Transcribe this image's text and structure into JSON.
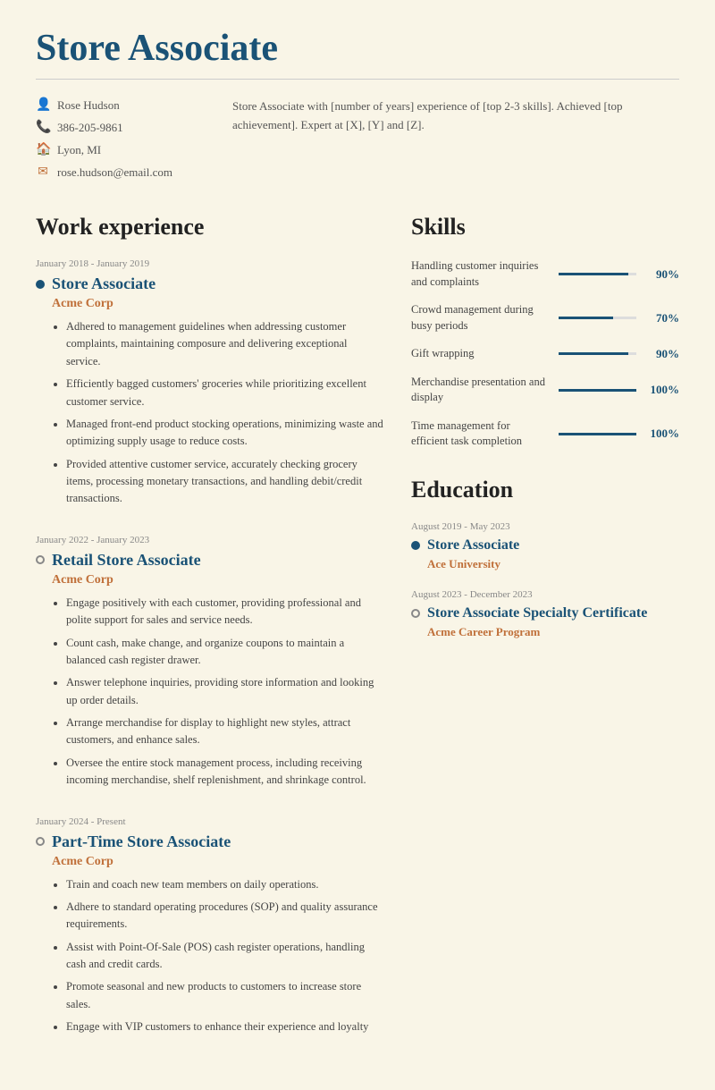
{
  "page": {
    "title": "Store Associate"
  },
  "contact": {
    "name": "Rose Hudson",
    "phone": "386-205-9861",
    "location": "Lyon, MI",
    "email": "rose.hudson@email.com"
  },
  "summary": "Store Associate with [number of years] experience of [top 2-3 skills]. Achieved [top achievement]. Expert at [X], [Y] and [Z].",
  "work_experience": {
    "section_title": "Work experience",
    "jobs": [
      {
        "date": "January 2018 - January 2019",
        "title": "Store Associate",
        "company": "Acme Corp",
        "bullet_type": "filled",
        "bullets": [
          "Adhered to management guidelines when addressing customer complaints, maintaining composure and delivering exceptional service.",
          "Efficiently bagged customers' groceries while prioritizing excellent customer service.",
          "Managed front-end product stocking operations, minimizing waste and optimizing supply usage to reduce costs.",
          "Provided attentive customer service, accurately checking grocery items, processing monetary transactions, and handling debit/credit transactions."
        ]
      },
      {
        "date": "January 2022 - January 2023",
        "title": "Retail Store Associate",
        "company": "Acme Corp",
        "bullet_type": "outline",
        "bullets": [
          "Engage positively with each customer, providing professional and polite support for sales and service needs.",
          "Count cash, make change, and organize coupons to maintain a balanced cash register drawer.",
          "Answer telephone inquiries, providing store information and looking up order details.",
          "Arrange merchandise for display to highlight new styles, attract customers, and enhance sales.",
          "Oversee the entire stock management process, including receiving incoming merchandise, shelf replenishment, and shrinkage control."
        ]
      },
      {
        "date": "January 2024 - Present",
        "title": "Part-Time Store Associate",
        "company": "Acme Corp",
        "bullet_type": "outline",
        "bullets": [
          "Train and coach new team members on daily operations.",
          "Adhere to standard operating procedures (SOP) and quality assurance requirements.",
          "Assist with Point-Of-Sale (POS) cash register operations, handling cash and credit cards.",
          "Promote seasonal and new products to customers to increase store sales.",
          "Engage with VIP customers to enhance their experience and loyalty"
        ]
      }
    ]
  },
  "skills": {
    "section_title": "Skills",
    "items": [
      {
        "name": "Handling customer inquiries and complaints",
        "percent": 90
      },
      {
        "name": "Crowd management during busy periods",
        "percent": 70
      },
      {
        "name": "Gift wrapping",
        "percent": 90
      },
      {
        "name": "Merchandise presentation and display",
        "percent": 100
      },
      {
        "name": "Time management for efficient task completion",
        "percent": 100
      }
    ]
  },
  "education": {
    "section_title": "Education",
    "entries": [
      {
        "date": "August 2019 - May 2023",
        "title": "Store Associate",
        "institution": "Ace University",
        "bullet_type": "filled"
      },
      {
        "date": "August 2023 - December 2023",
        "title": "Store Associate Specialty Certificate",
        "institution": "Acme Career Program",
        "bullet_type": "outline"
      }
    ]
  }
}
